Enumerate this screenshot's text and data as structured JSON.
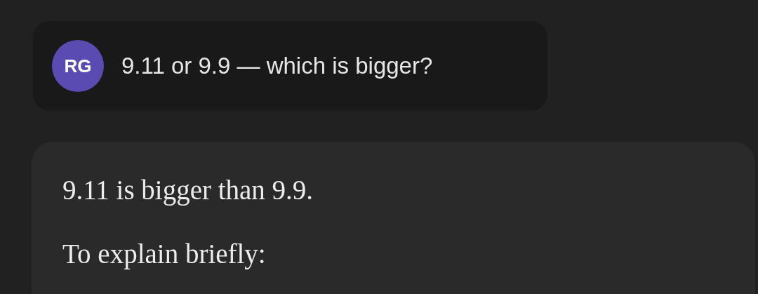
{
  "user_message": {
    "avatar_initials": "RG",
    "text": "9.11 or 9.9 — which is bigger?"
  },
  "response": {
    "paragraphs": [
      "9.11 is bigger than 9.9.",
      "To explain briefly:"
    ]
  }
}
